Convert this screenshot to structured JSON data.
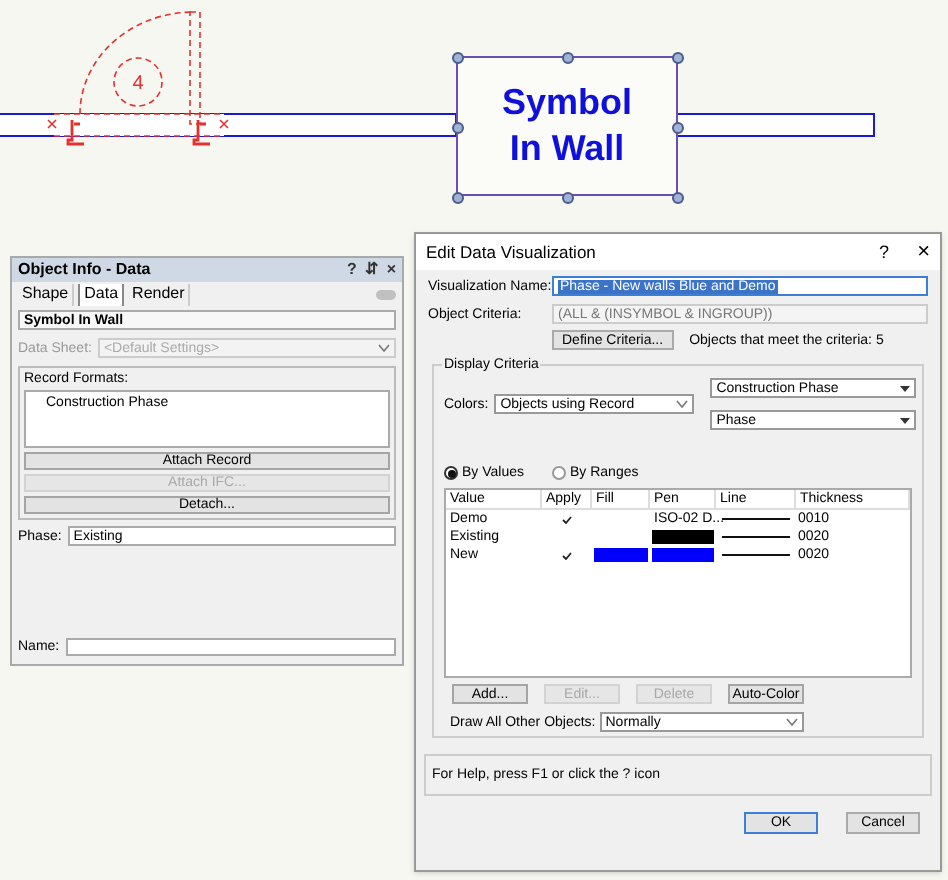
{
  "canvas": {
    "door_tag": "4",
    "symbol_label": [
      "Symbol",
      "In Wall"
    ]
  },
  "object_info": {
    "title": "Object Info - Data",
    "title_buttons": [
      "?",
      "⇵",
      "×"
    ],
    "tabs": [
      {
        "label": "Shape",
        "selected": false
      },
      {
        "label": "Data",
        "selected": true
      },
      {
        "label": "Render",
        "selected": false
      }
    ],
    "object_name": "Symbol In Wall",
    "data_sheet": {
      "label": "Data Sheet:",
      "value": "<Default Settings>",
      "disabled": true
    },
    "record_formats": {
      "label": "Record Formats:",
      "items": [
        "Construction Phase"
      ]
    },
    "buttons": [
      {
        "label": "Attach Record",
        "disabled": false
      },
      {
        "label": "Attach IFC...",
        "disabled": true
      },
      {
        "label": "Detach...",
        "disabled": false
      }
    ],
    "phase": {
      "label": "Phase:",
      "value": "Existing"
    },
    "name": {
      "label": "Name:"
    }
  },
  "dialog": {
    "title": "Edit Data Visualization",
    "help_button": "?",
    "close_button": "×",
    "visualization_name": {
      "label": "Visualization Name:",
      "value": "Phase - New walls Blue and Demo"
    },
    "object_criteria": {
      "label": "Object Criteria:",
      "value": "(ALL & (INSYMBOL & INGROUP))"
    },
    "define_criteria_button": "Define Criteria...",
    "criteria_count": "Objects that meet the criteria: 5",
    "display_criteria": {
      "label": "Display Criteria",
      "colors_label": "Colors:",
      "colors_value": "Objects using Record",
      "record_value": "Construction Phase",
      "field_value": "Phase",
      "modes": [
        {
          "label": "By Values",
          "selected": true
        },
        {
          "label": "By Ranges",
          "selected": false
        }
      ],
      "table": {
        "columns": [
          "Value",
          "Apply",
          "Fill",
          "Pen",
          "Line",
          "Thickness"
        ],
        "rows": [
          {
            "value": "Demo",
            "apply": true,
            "pen": {
              "kind": "text",
              "text": "ISO-02 D..."
            },
            "thickness": "0010"
          },
          {
            "value": "Existing",
            "apply": false,
            "pen": {
              "kind": "swatch",
              "color": "#000000"
            },
            "thickness": "0020"
          },
          {
            "value": "New",
            "apply": true,
            "fill": {
              "color": "#0000ff"
            },
            "pen": {
              "kind": "swatch",
              "color": "#0000ff"
            },
            "thickness": "0020"
          }
        ]
      },
      "buttons": [
        {
          "label": "Add...",
          "disabled": false
        },
        {
          "label": "Edit...",
          "disabled": true
        },
        {
          "label": "Delete",
          "disabled": true
        },
        {
          "label": "Auto-Color",
          "disabled": false
        }
      ],
      "draw_others_label": "Draw All Other Objects:",
      "draw_others_value": "Normally"
    },
    "help_text": "For Help, press F1 or click the ? icon",
    "ok_button": "OK",
    "cancel_button": "Cancel"
  }
}
